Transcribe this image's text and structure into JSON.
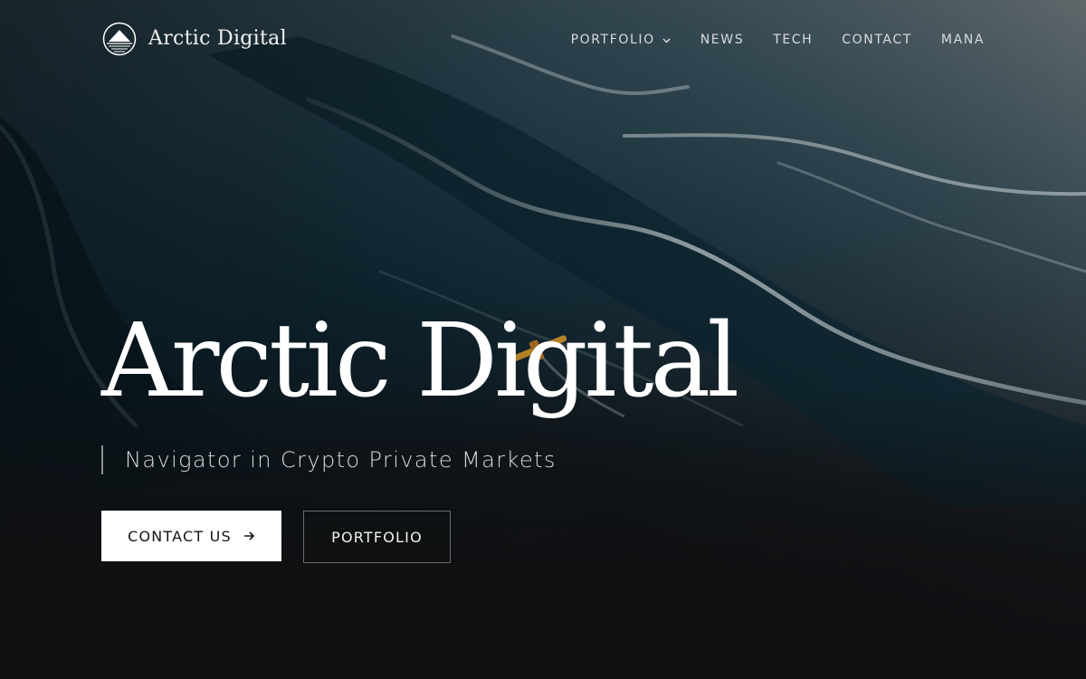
{
  "brand": {
    "name": "Arctic Digital",
    "logo_icon": "mountain-sunrise-circle-icon"
  },
  "nav": {
    "items": [
      {
        "label": "PORTFOLIO",
        "has_dropdown": true,
        "icon": "chevron-down-icon"
      },
      {
        "label": "NEWS"
      },
      {
        "label": "TECH"
      },
      {
        "label": "CONTACT"
      },
      {
        "label": "MANA"
      }
    ]
  },
  "hero": {
    "title": "Arctic Digital",
    "tagline": "Navigator in Crypto Private Markets",
    "primary_button": {
      "label": "CONTACT US",
      "icon": "arrow-right-icon"
    },
    "secondary_button": {
      "label": "PORTFOLIO"
    },
    "background_image": "aerial-arctic-ice-meltwater-with-boat-image"
  },
  "colors": {
    "background": "#0f1012",
    "water_dark": "#0e2733",
    "water_mid": "#2b4a58",
    "ice_highlight": "#c7d1d4",
    "boat_accent": "#d49a2e",
    "primary_button_bg": "#ffffff",
    "primary_button_text": "#141516"
  }
}
